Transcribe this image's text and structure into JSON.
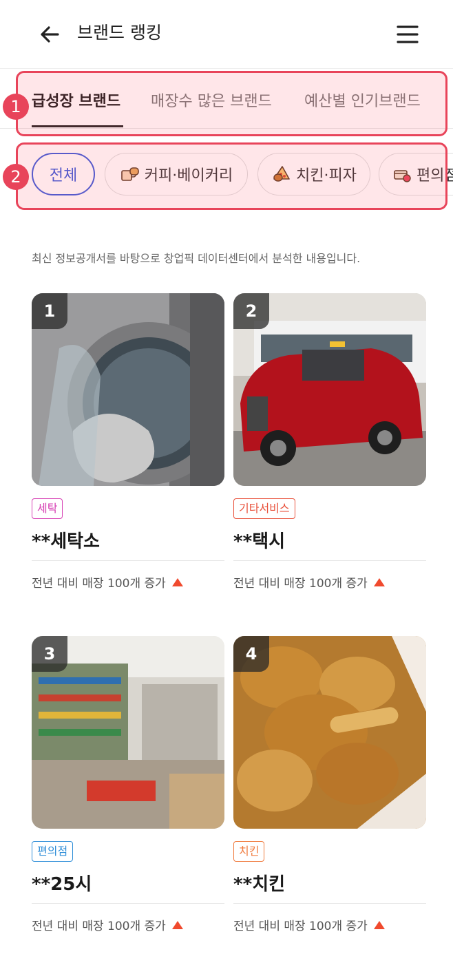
{
  "header": {
    "title": "브랜드 랭킹",
    "back_icon": "arrow-left-icon",
    "menu_icon": "hamburger-menu-icon"
  },
  "tabs": [
    {
      "label": "급성장 브랜드",
      "active": true
    },
    {
      "label": "매장수 많은 브랜드",
      "active": false
    },
    {
      "label": "예산별 인기브랜드",
      "active": false
    }
  ],
  "annotations": [
    "1",
    "2"
  ],
  "chips": [
    {
      "label": "전체",
      "icon": "",
      "active": true
    },
    {
      "label": "커피·베이커리",
      "icon": "coffee-bread-icon",
      "active": false
    },
    {
      "label": "치킨·피자",
      "icon": "chicken-pizza-icon",
      "active": false
    },
    {
      "label": "편의점",
      "icon": "convenience-store-icon",
      "active": false
    }
  ],
  "note": "최신 정보공개서를 바탕으로 창업픽 데이터센터에서 분석한 내용입니다.",
  "cards": [
    {
      "rank": "1",
      "category": "세탁",
      "category_color": "#d63fb3",
      "name": "**세탁소",
      "stat": "전년 대비 매장 100개 증가",
      "image": "washing-machine-photo"
    },
    {
      "rank": "2",
      "category": "기타서비스",
      "category_color": "#e8503a",
      "name": "**택시",
      "stat": "전년 대비 매장 100개 증가",
      "image": "red-taxi-photo"
    },
    {
      "rank": "3",
      "category": "편의점",
      "category_color": "#2f8ed8",
      "name": "**25시",
      "stat": "전년 대비 매장 100개 증가",
      "image": "convenience-store-photo"
    },
    {
      "rank": "4",
      "category": "치킨",
      "category_color": "#f07a3c",
      "name": "**치킨",
      "stat": "전년 대비 매장 100개 증가",
      "image": "fried-chicken-photo"
    }
  ],
  "colors": {
    "accent": "#3b5bdb",
    "annotation": "#e8445a",
    "up": "#f04a2e"
  }
}
